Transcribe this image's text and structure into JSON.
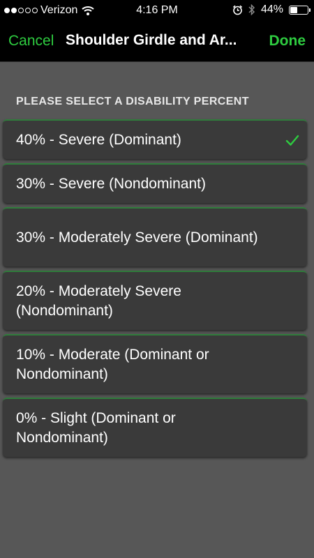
{
  "status_bar": {
    "carrier": "Verizon",
    "time": "4:16 PM",
    "battery": "44%",
    "battery_level": 0.44,
    "signal_bars_filled": 2,
    "signal_bars_total": 5
  },
  "nav": {
    "cancel_label": "Cancel",
    "title": "Shoulder Girdle and Ar...",
    "done_label": "Done"
  },
  "section_header": "PLEASE SELECT A DISABILITY PERCENT",
  "options": [
    {
      "label": "40% - Severe (Dominant)",
      "selected": true
    },
    {
      "label": "30% - Severe (Nondominant)",
      "selected": false
    },
    {
      "label": "30% - Moderately Severe (Dominant)",
      "selected": false
    },
    {
      "label": "20% - Moderately Severe (Nondominant)",
      "selected": false
    },
    {
      "label": "10% - Moderate (Dominant or Nondominant)",
      "selected": false
    },
    {
      "label": "0% - Slight (Dominant or Nondominant)",
      "selected": false
    }
  ],
  "colors": {
    "accent": "#2ecc40",
    "background": "#575757",
    "option_background": "#3a3a3a",
    "option_border": "#2f7d3b",
    "nav_background": "#000000"
  },
  "icons": {
    "checkmark": "checkmark-icon",
    "wifi": "wifi-icon",
    "alarm": "alarm-icon",
    "bluetooth": "bluetooth-icon",
    "battery": "battery-icon"
  }
}
